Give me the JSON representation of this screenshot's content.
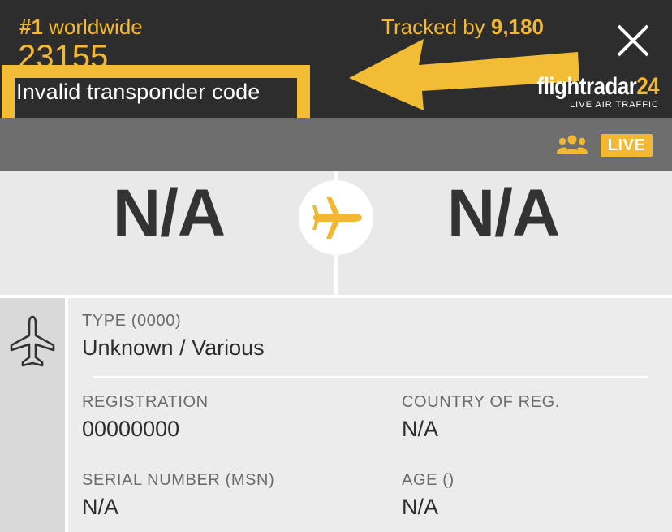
{
  "header": {
    "flight_code": "23155",
    "annotation_text": "Invalid transponder code",
    "close_icon": "close-icon",
    "logo": {
      "main": "flightradar",
      "num": "24",
      "sub": "LIVE AIR TRAFFIC"
    }
  },
  "stats": {
    "rank_prefix": "#1",
    "rank_suffix": " worldwide",
    "tracked_prefix": "Tracked by ",
    "tracked_count": "9,180",
    "people_icon": "people-icon",
    "live_label": "LIVE"
  },
  "route": {
    "origin": "N/A",
    "destination": "N/A",
    "plane_icon": "airplane-icon"
  },
  "info": {
    "side_icon": "airplane-outline-icon",
    "type_label": "TYPE (0000)",
    "type_value": "Unknown / Various",
    "registration_label": "REGISTRATION",
    "registration_value": "00000000",
    "country_label": "COUNTRY OF REG.",
    "country_value": "N/A",
    "serial_label": "SERIAL NUMBER (MSN)",
    "serial_value": "N/A",
    "age_label": "AGE ()",
    "age_value": "N/A"
  },
  "colors": {
    "accent": "#f2b833",
    "header_bg": "#2d2d2d",
    "stats_bg": "#6e6e6e",
    "panel_bg": "#e9e9e9"
  }
}
